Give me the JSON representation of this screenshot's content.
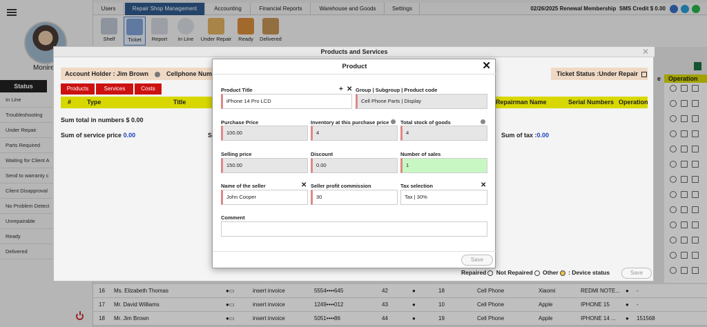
{
  "nav": {
    "tabs": [
      "Users",
      "Repair Shop Management",
      "Accounting",
      "Financial Reports",
      "Warehouse and Goods",
      "Settings"
    ],
    "active_tab": "Repair Shop Management",
    "date_renewal": "02/26/2025 Renewal Membership",
    "sms_credit": "SMS Credit $ 0.00"
  },
  "toolbar": {
    "items": [
      "Shelf",
      "Ticket",
      "Report",
      "In Line",
      "Under Repair",
      "Ready",
      "Delivered"
    ]
  },
  "sidebar": {
    "user_name": "Monire",
    "status_title": "Status",
    "items": [
      "In Line",
      "Troubleshooting",
      "Under Repair",
      "Parts Required",
      "Waiting for Client A",
      "Send to warranty c",
      "Client Disapproval",
      "No Problem Detect",
      "Unrepairable",
      "Ready",
      "Delivered"
    ]
  },
  "right_col": {
    "operation": "Operation",
    "e_header": "e"
  },
  "products_modal": {
    "title": "Products and Services",
    "account_holder": "Account Holder : Jim Brown",
    "cellphone_label": "Cellphone Numb",
    "ticket_status": "Ticket Status :Under Repair",
    "tabs": [
      "Products",
      "Services",
      "Costs"
    ],
    "columns": [
      "#",
      "Type",
      "Title",
      "Repairman Name",
      "Serial Numbers",
      "Operation"
    ],
    "sum_total": "Sum total in numbers $ 0.00",
    "sum_service_label": "Sum of service price",
    "sum_service_value": "0.00",
    "sum_tax_label": "Sum of tax :",
    "sum_tax_value": "0.00",
    "partial_s": "S",
    "radio_repaired": "Repaired",
    "radio_not_repaired": "Not Repaired",
    "radio_other": "Other",
    "device_status": ": Device status",
    "save": "Save"
  },
  "product_dialog": {
    "title": "Product",
    "fields": {
      "product_title": {
        "label": "Product Title",
        "value": "iPhone 14 Pro LCD"
      },
      "group": {
        "label": "Group | Subgroup | Product code",
        "value": "Cell Phone Parts | Display"
      },
      "purchase_price": {
        "label": "Purchase Price",
        "value": "100.00"
      },
      "inventory": {
        "label": "Inventory at this purchase price",
        "value": "4"
      },
      "total_stock": {
        "label": "Total stock of goods",
        "value": "4"
      },
      "selling_price": {
        "label": "Selling price",
        "value": "150.00"
      },
      "discount": {
        "label": "Discount",
        "value": "0.00"
      },
      "number_of_sales": {
        "label": "Number of sales",
        "value": "1"
      },
      "seller_name": {
        "label": "Name of the seller",
        "value": "John Cooper"
      },
      "profit_commission": {
        "label": "Seller profit commission",
        "value": "30"
      },
      "tax_selection": {
        "label": "Tax selection",
        "value": "Tax | 30%"
      },
      "comment": {
        "label": "Comment",
        "value": ""
      }
    },
    "save": "Save"
  },
  "table_rows": [
    {
      "id": "16",
      "name": "Ms. Elizabeth Thomas",
      "invoice": "insert invoice",
      "phone": "5554••••645",
      "c1": "42",
      "c2": "18",
      "type": "Cell Phone",
      "brand": "Xiaomi",
      "model": "REDMI NOTE...",
      "tail": "-"
    },
    {
      "id": "17",
      "name": "Mr. David Williams",
      "invoice": "insert invoice",
      "phone": "1249••••012",
      "c1": "43",
      "c2": "10",
      "type": "Cell Phone",
      "brand": "Apple",
      "model": "IPHONE 15",
      "tail": "-"
    },
    {
      "id": "18",
      "name": "Mr. Jim Brown",
      "invoice": "insert invoice",
      "phone": "5051••••86",
      "c1": "44",
      "c2": "19",
      "type": "Cell Phone",
      "brand": "Apple",
      "model": "IPHONE 14 ...",
      "tail": "151568"
    }
  ]
}
